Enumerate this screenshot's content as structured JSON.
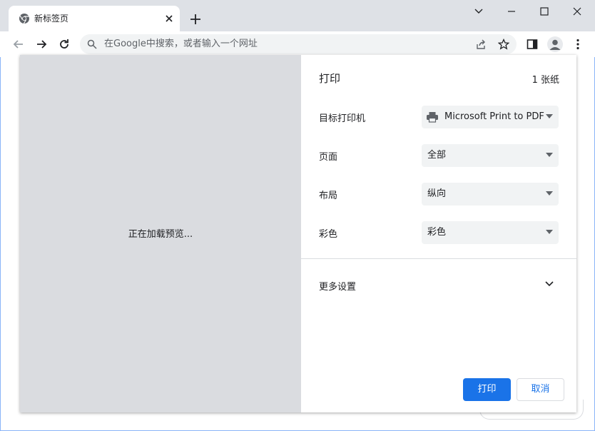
{
  "browser": {
    "tab": {
      "title": "新标签页",
      "favicon": "chrome-icon"
    },
    "omnibox": {
      "placeholder": "在Google中搜索，或者输入一个网址"
    },
    "icons": [
      "back-arrow-icon",
      "forward-arrow-icon",
      "reload-icon",
      "search-icon",
      "share-icon",
      "star-icon",
      "side-panel-icon",
      "profile-icon",
      "menu-dots-icon",
      "minimize-icon",
      "maximize-icon",
      "close-icon",
      "chevron-down-icon",
      "plus-icon"
    ]
  },
  "print_dialog": {
    "preview_text": "正在加载预览...",
    "title": "打印",
    "sheet_count": "1 张纸",
    "rows": [
      {
        "label": "目标打印机",
        "value": "Microsoft Print to PDF",
        "icon": "printer-icon"
      },
      {
        "label": "页面",
        "value": "全部"
      },
      {
        "label": "布局",
        "value": "纵向"
      },
      {
        "label": "彩色",
        "value": "彩色"
      }
    ],
    "more_settings": "更多设置",
    "print_button": "打印",
    "cancel_button": "取消"
  },
  "colors": {
    "accent": "#1a73e8",
    "titlebar": "#dee1e6",
    "preview_bg": "#dadce0",
    "select_bg": "#f1f3f4"
  }
}
